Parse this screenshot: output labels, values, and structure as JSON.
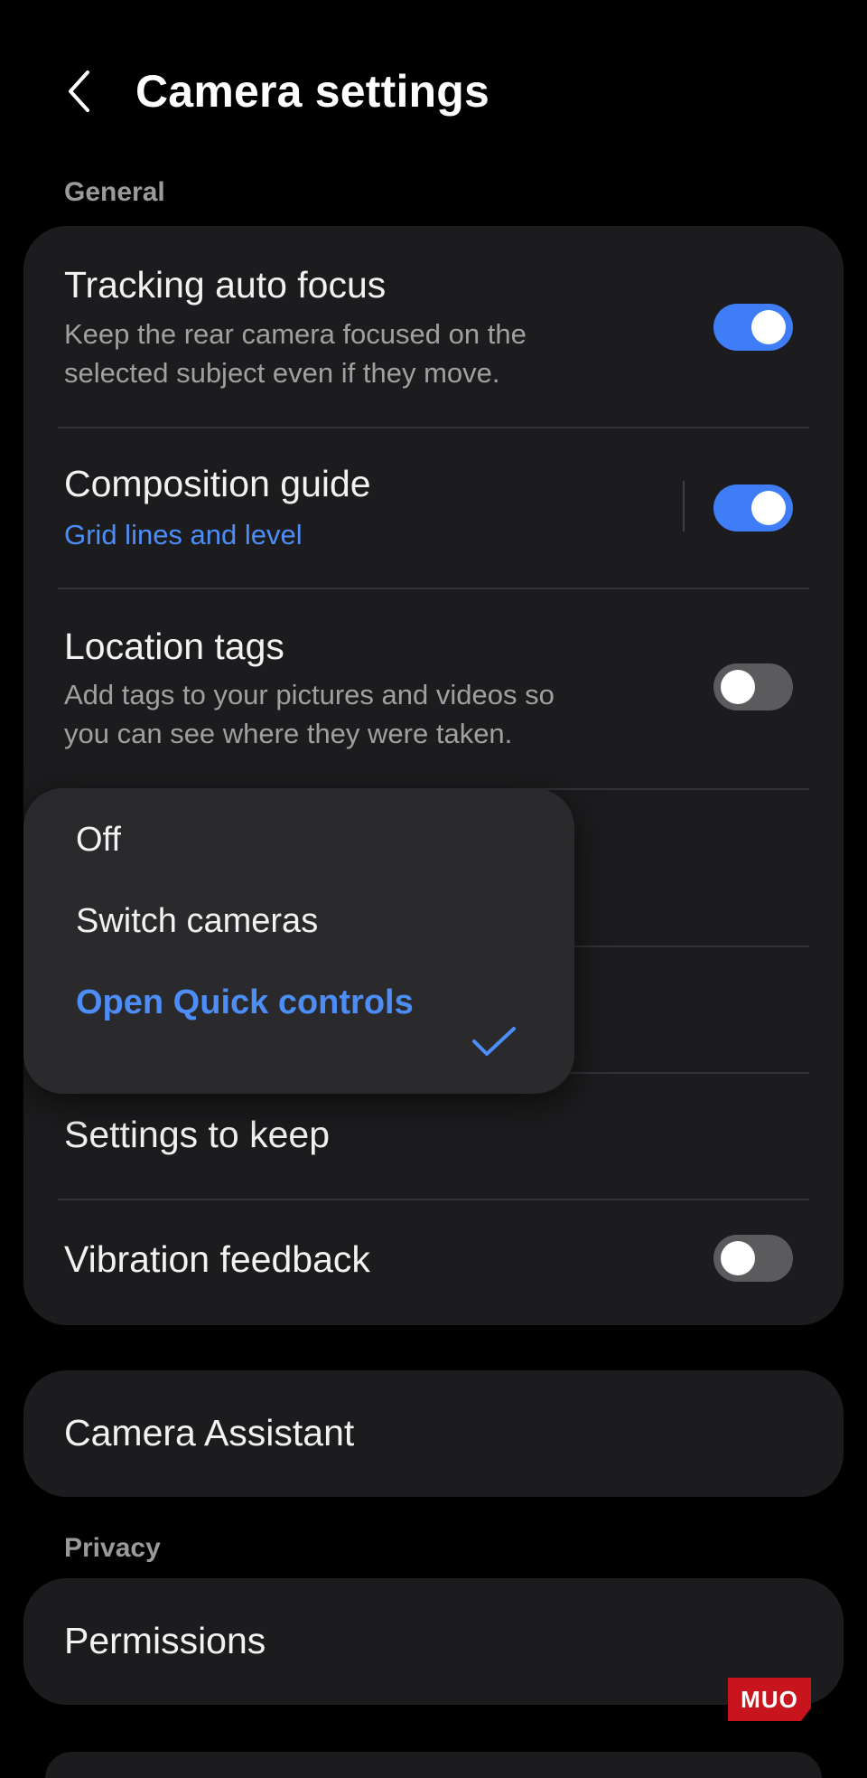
{
  "header": {
    "title": "Camera settings"
  },
  "sections": {
    "general": "General",
    "privacy": "Privacy"
  },
  "general_card": {
    "tracking": {
      "title": "Tracking auto focus",
      "desc": "Keep the rear camera focused on the selected subject even if they move.",
      "enabled": true
    },
    "composition": {
      "title": "Composition guide",
      "sub": "Grid lines and level",
      "enabled": true
    },
    "location": {
      "title": "Location tags",
      "desc": "Add tags to your pictures and videos so you can see where they were taken.",
      "enabled": false
    },
    "settings_keep": {
      "title": "Settings to keep"
    },
    "vibration": {
      "title": "Vibration feedback",
      "enabled": false
    }
  },
  "camera_assistant": {
    "title": "Camera Assistant"
  },
  "permissions": {
    "title": "Permissions"
  },
  "popup": {
    "options": [
      "Off",
      "Switch cameras",
      "Open Quick controls"
    ],
    "selected": "Open Quick controls"
  },
  "watermark": "MUO",
  "colors": {
    "accent": "#3e7df5",
    "link": "#4d8df7",
    "card": "#1c1c1e",
    "background": "#000000"
  }
}
